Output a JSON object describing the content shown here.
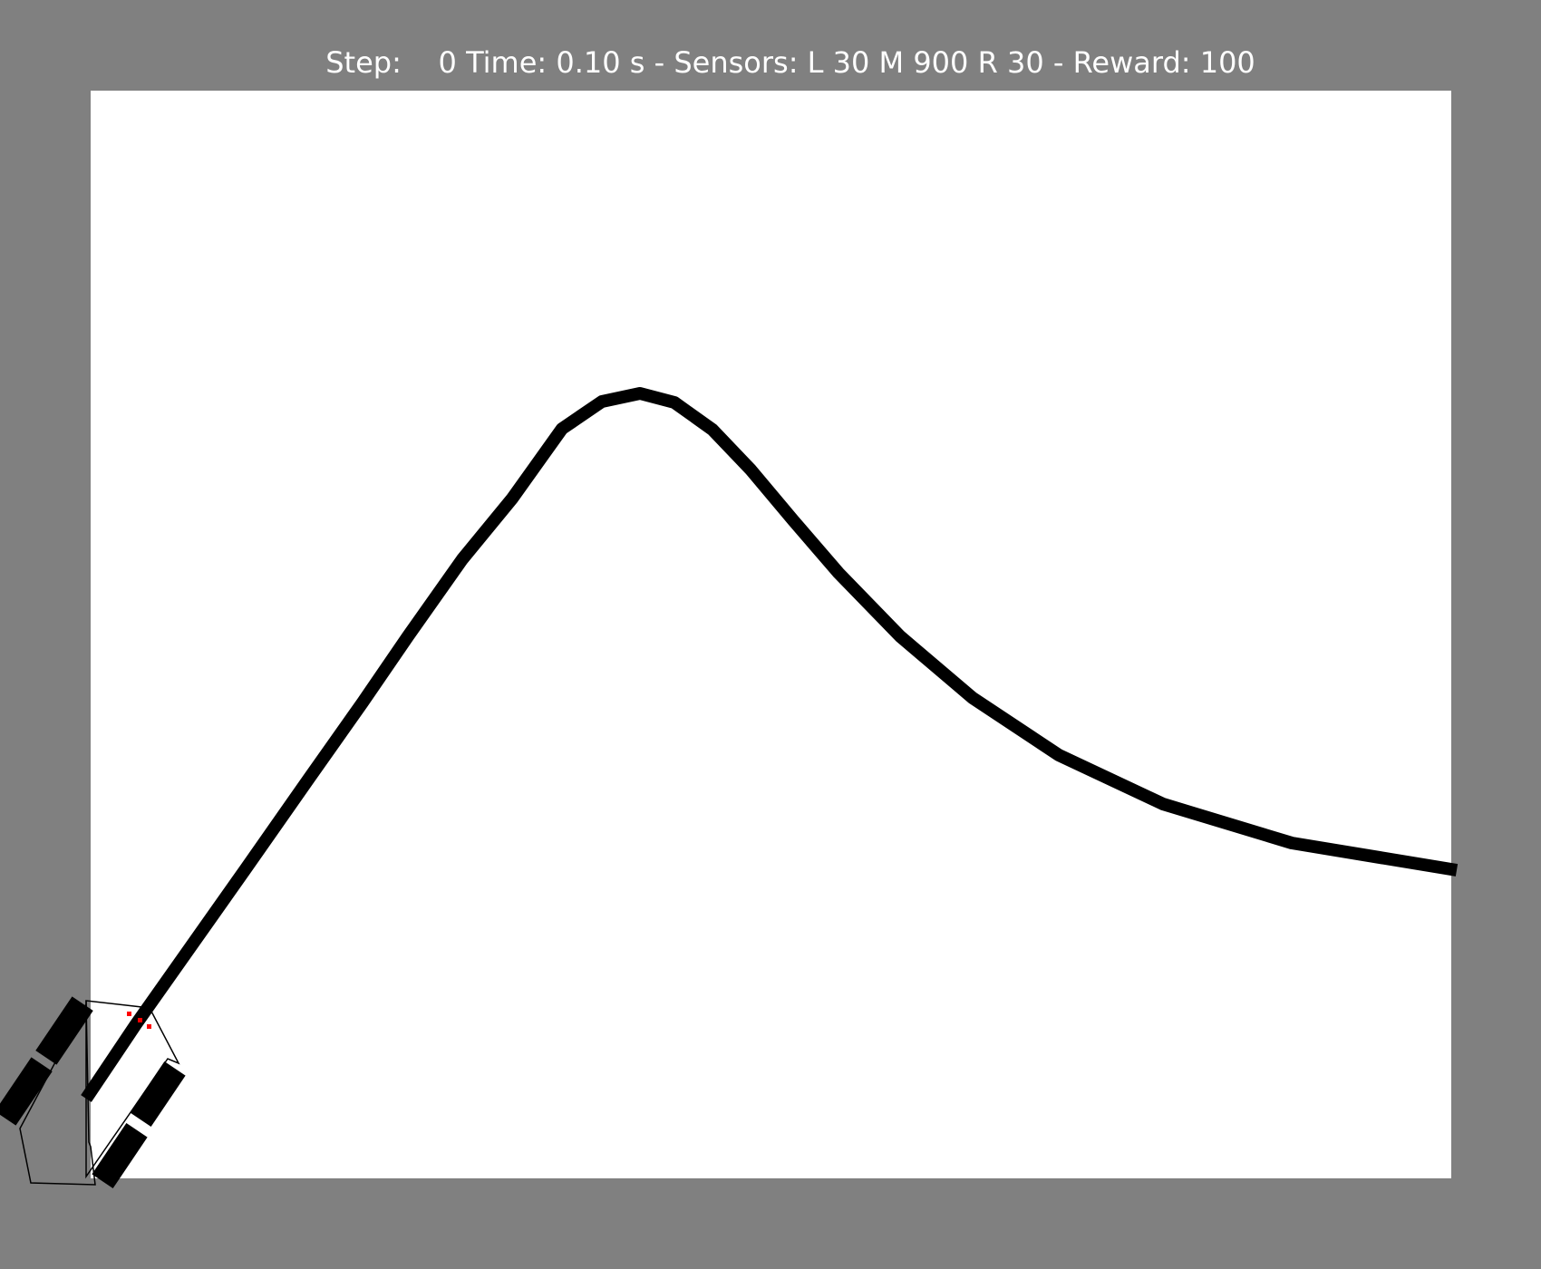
{
  "status_bar": {
    "text": "Step:    0 Time: 0.10 s - Sensors: L 30 M 900 R 30 - Reward: 100"
  },
  "colors": {
    "background": "#808080",
    "arena": "#ffffff",
    "track": "#000000",
    "robot_outline": "#000000",
    "robot_wheels": "#000000",
    "sensor_markers": "#ff0000",
    "status_text": "#ffffff"
  }
}
